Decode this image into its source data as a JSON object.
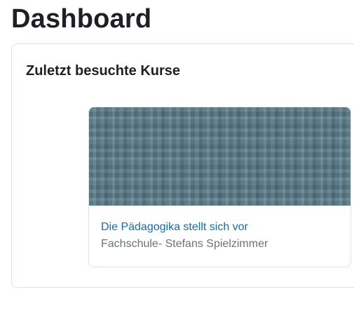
{
  "page": {
    "title": "Dashboard"
  },
  "recent_courses_block": {
    "title": "Zuletzt besuchte Kurse",
    "courses": [
      {
        "name": "Die Pädagogika stellt sich vor",
        "category": "Fachschule- Stefans Spielzimmer",
        "image_colors": {
          "base": "#5a7b88",
          "accent": "#6f8e99"
        }
      }
    ]
  },
  "colors": {
    "link": "#0f6cbf",
    "muted_text": "#6a737b",
    "border": "#dee2e6"
  }
}
